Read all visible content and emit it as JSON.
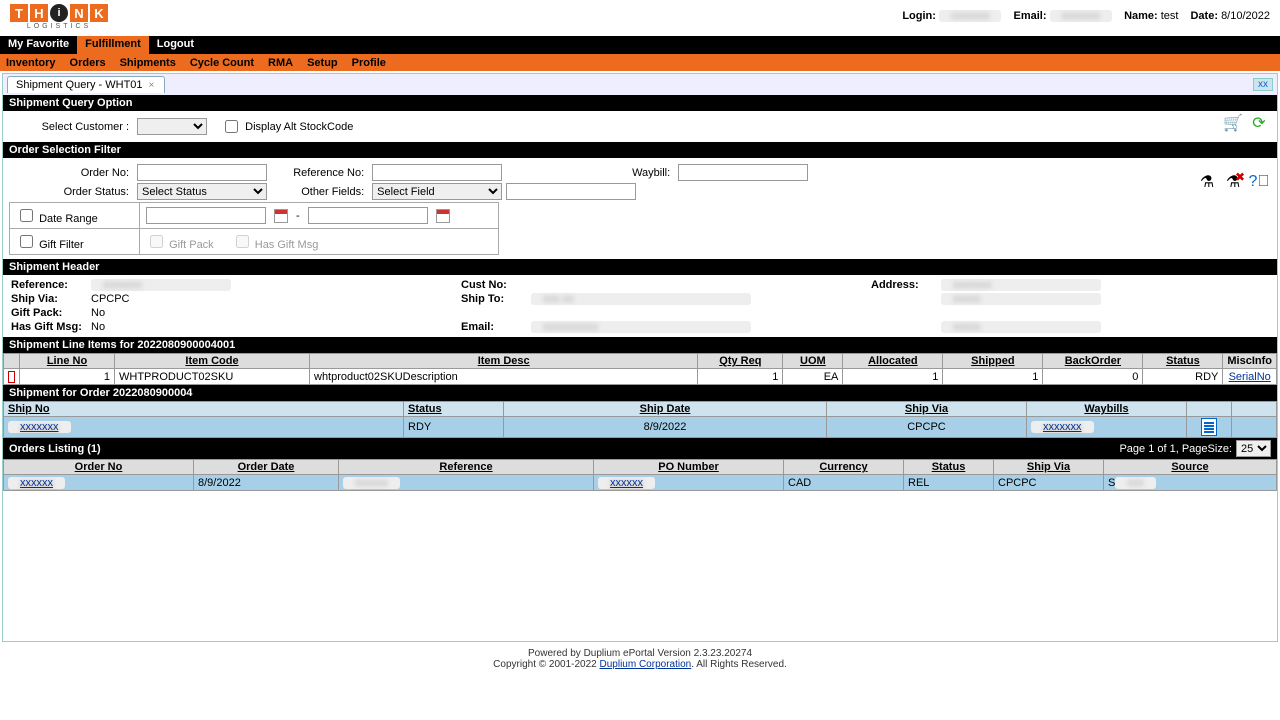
{
  "logo_text": [
    "T",
    "H",
    "i",
    "N",
    "K"
  ],
  "logo_sub": "LOGISTICS",
  "user": {
    "login_label": "Login:",
    "email_label": "Email:",
    "name_label": "Name:",
    "name_value": "test",
    "date_label": "Date:",
    "date_value": "8/10/2022"
  },
  "nav1": {
    "my_favorite": "My Favorite",
    "fulfillment": "Fulfillment",
    "logout": "Logout"
  },
  "nav2": [
    "Inventory",
    "Orders",
    "Shipments",
    "Cycle Count",
    "RMA",
    "Setup",
    "Profile"
  ],
  "doc_tab": "Shipment Query - WHT01",
  "close_xx": "xx",
  "section": {
    "query_option": "Shipment Query Option",
    "order_filter": "Order Selection Filter",
    "ship_header": "Shipment Header",
    "line_items": "Shipment Line Items for 2022080900004001",
    "ship_for_order": "Shipment for Order 2022080900004",
    "orders_listing": "Orders Listing (1)"
  },
  "query": {
    "select_customer_label": "Select Customer :",
    "display_alt": "Display Alt StockCode"
  },
  "filter": {
    "order_no": "Order No:",
    "reference_no": "Reference No:",
    "waybill": "Waybill:",
    "order_status": "Order Status:",
    "status_placeholder": "Select Status",
    "other_fields": "Other Fields:",
    "other_placeholder": "Select Field",
    "date_range": "Date Range",
    "gift_filter": "Gift Filter",
    "gift_pack": "Gift Pack",
    "has_gift_msg": "Has Gift Msg"
  },
  "header": {
    "reference_k": "Reference:",
    "ship_via_k": "Ship Via:",
    "ship_via_v": "CPCPC",
    "gift_pack_k": "Gift Pack:",
    "gift_pack_v": "No",
    "has_gift_msg_k": "Has Gift Msg:",
    "has_gift_msg_v": "No",
    "cust_no_k": "Cust No:",
    "ship_to_k": "Ship To:",
    "email_k": "Email:",
    "address_k": "Address:"
  },
  "line_cols": [
    "Line No",
    "Item Code",
    "Item Desc",
    "Qty Req",
    "UOM",
    "Allocated",
    "Shipped",
    "BackOrder",
    "Status",
    "MiscInfo"
  ],
  "line_row": {
    "line_no": "1",
    "item_code": "WHTPRODUCT02SKU",
    "item_desc": "whtproduct02SKUDescription",
    "qty_req": "1",
    "uom": "EA",
    "allocated": "1",
    "shipped": "1",
    "backorder": "0",
    "status": "RDY",
    "misc": "SerialNo"
  },
  "ship_cols": [
    "Ship No",
    "Status",
    "Ship Date",
    "Ship Via",
    "Waybills",
    ""
  ],
  "ship_row": {
    "status": "RDY",
    "ship_date": "8/9/2022",
    "ship_via": "CPCPC"
  },
  "orders": {
    "page_info": "Page 1 of 1, PageSize:",
    "page_size": "25",
    "cols": [
      "Order No",
      "Order Date",
      "Reference",
      "PO Number",
      "Currency",
      "Status",
      "Ship Via",
      "Source"
    ],
    "row": {
      "order_date": "8/9/2022",
      "currency": "CAD",
      "status": "REL",
      "ship_via": "CPCPC",
      "source": "S"
    }
  },
  "footer": {
    "line1": "Powered by Duplium ePortal Version 2.3.23.20274",
    "line2a": "Copyright © 2001-2022 ",
    "corp": "Duplium Corporation",
    "line2b": ". All Rights Reserved."
  }
}
